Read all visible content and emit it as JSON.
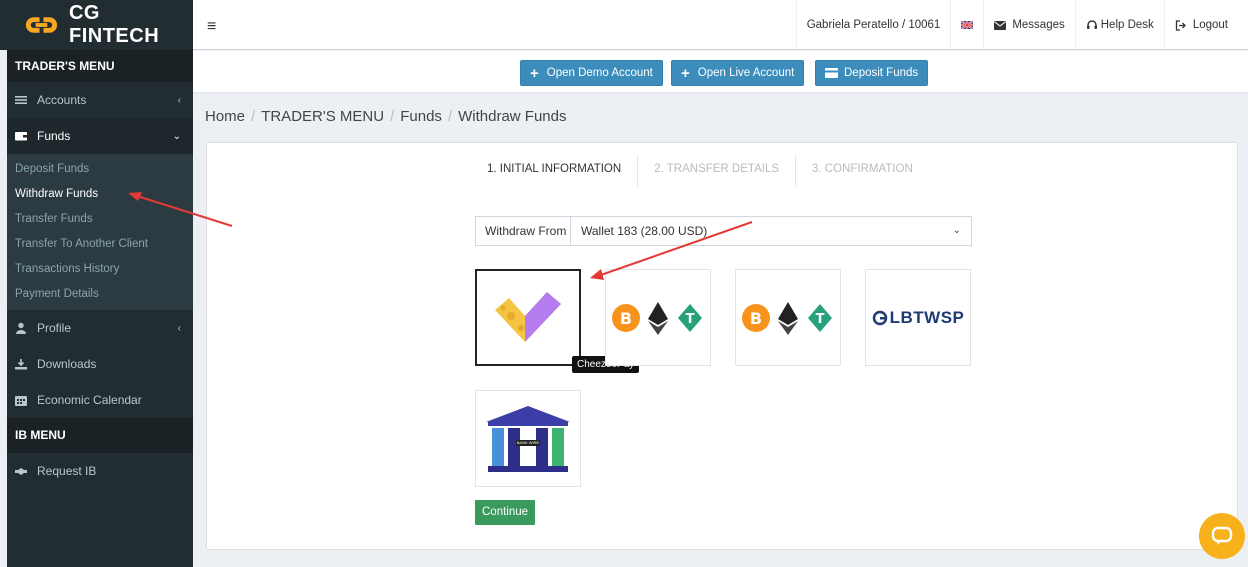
{
  "brand": {
    "name": "CG FINTECH"
  },
  "topbar": {
    "menu_icon": "hamburger-icon",
    "user": "Gabriela Peratello / 10061",
    "flag_icon": "uk-flag-icon",
    "messages": "Messages",
    "help_desk": "Help Desk",
    "logout": "Logout"
  },
  "actions": {
    "open_demo": "Open Demo Account",
    "open_live": "Open Live Account",
    "deposit": "Deposit Funds"
  },
  "sidebar": {
    "traders_menu": "TRADER'S MENU",
    "accounts": "Accounts",
    "funds": "Funds",
    "funds_sub": [
      "Deposit Funds",
      "Withdraw Funds",
      "Transfer Funds",
      "Transfer To Another Client",
      "Transactions History",
      "Payment Details"
    ],
    "profile": "Profile",
    "downloads": "Downloads",
    "economic_calendar": "Economic Calendar",
    "ib_menu": "IB MENU",
    "request_ib": "Request IB"
  },
  "breadcrumb": [
    "Home",
    "TRADER'S MENU",
    "Funds",
    "Withdraw Funds"
  ],
  "steps": [
    "1. INITIAL INFORMATION",
    "2. TRANSFER DETAILS",
    "3. CONFIRMATION"
  ],
  "withdraw": {
    "label": "Withdraw From",
    "value": "Wallet 183 (28.00 USD)"
  },
  "methods": {
    "tooltip": "CheezeePay",
    "lbtwsp": "LBTWSP",
    "bank_wire_label": "BANK WIRE"
  },
  "continue": "Continue",
  "colors": {
    "primary": "#3c8dbc",
    "success": "#3a9a5e",
    "sidebar": "#222d32",
    "annotation_arrow": "#e53935",
    "chat": "#f7b21b"
  }
}
